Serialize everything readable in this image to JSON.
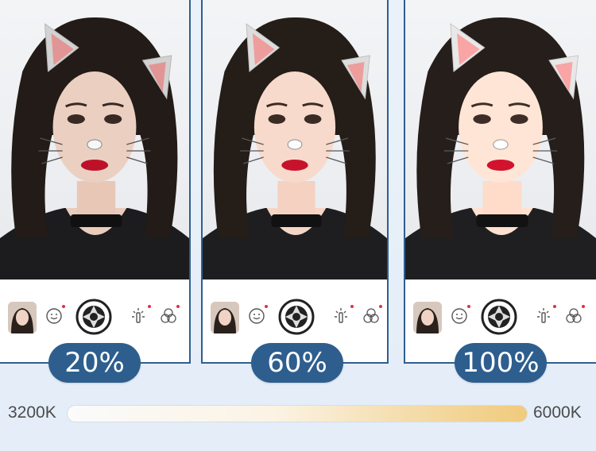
{
  "panels": [
    {
      "percent_label": "20%"
    },
    {
      "percent_label": "60%"
    },
    {
      "percent_label": "100%"
    }
  ],
  "toolbar_icons": [
    "avatar-thumbnail",
    "smile-icon",
    "shutter-icon",
    "magic-wand-icon",
    "filter-circles-icon"
  ],
  "scale": {
    "left_label": "3200K",
    "right_label": "6000K"
  },
  "colors": {
    "pill": "#2d5e8e",
    "panel_border": "#2f5f8f",
    "notification_dot": "#e0304a"
  }
}
